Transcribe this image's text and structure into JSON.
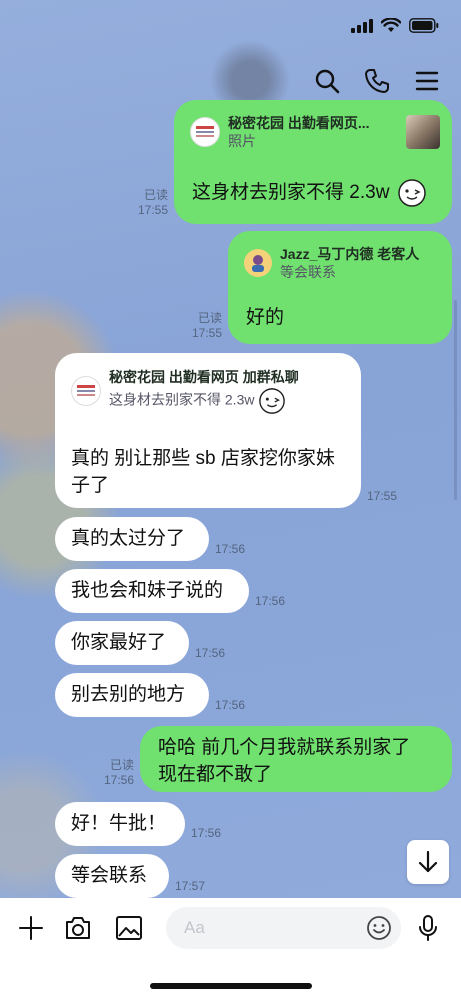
{
  "status_bar": {
    "time": ""
  },
  "header": {
    "icons": [
      "search-icon",
      "phone-icon",
      "menu-icon"
    ]
  },
  "messages": [
    {
      "side": "right",
      "quote": {
        "name": "秘密花园 出勤看网页...",
        "text": "照片"
      },
      "text": "这身材去别家不得 2.3w",
      "read": "已读",
      "time": "17:55"
    },
    {
      "side": "right",
      "quote": {
        "name": "Jazz_马丁内德 老客人",
        "text": "等会联系"
      },
      "text": "好的",
      "read": "已读",
      "time": "17:55"
    },
    {
      "side": "left",
      "quote": {
        "name": "秘密花园 出勤看网页 加群私聊",
        "text": "这身材去别家不得 2.3w"
      },
      "text_line1": "真的 别让那些 sb 店家挖你家妹",
      "text_line2": "子了",
      "time": "17:55"
    },
    {
      "side": "left",
      "text": "真的太过分了",
      "time": "17:56"
    },
    {
      "side": "left",
      "text": "我也会和妹子说的",
      "time": "17:56"
    },
    {
      "side": "left",
      "text": "你家最好了",
      "time": "17:56"
    },
    {
      "side": "left",
      "text": "别去别的地方",
      "time": "17:56"
    },
    {
      "side": "right",
      "text_line1": "哈哈 前几个月我就联系别家了",
      "text_line2": "现在都不敢了",
      "read": "已读",
      "time": "17:56"
    },
    {
      "side": "left",
      "text": "好！牛批！",
      "time": "17:56"
    },
    {
      "side": "left",
      "text": "等会联系",
      "time": "17:57"
    }
  ],
  "input_bar": {
    "placeholder": "Aa",
    "icons": [
      "plus-icon",
      "camera-icon",
      "image-icon",
      "emoji-icon",
      "microphone-icon"
    ]
  },
  "colors": {
    "green_bubble": "#70e06f",
    "white_bubble": "#ffffff",
    "background": "#8aa6d8"
  }
}
